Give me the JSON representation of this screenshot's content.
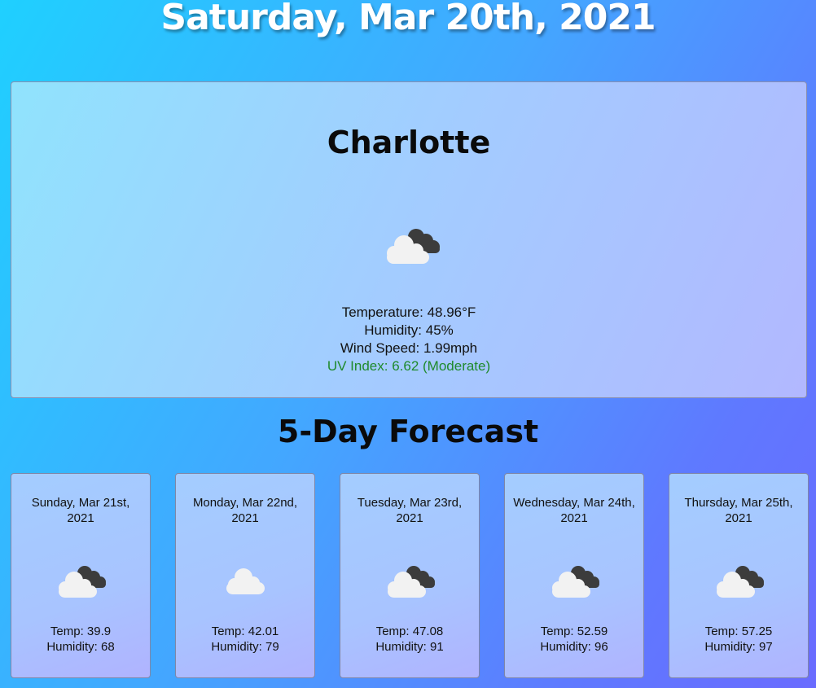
{
  "header": {
    "date": "Saturday, Mar 20th, 2021"
  },
  "current": {
    "city": "Charlotte",
    "icon": "cloudy-icon",
    "temperature": "Temperature: 48.96°F",
    "humidity": "Humidity: 45%",
    "wind": "Wind Speed: 1.99mph",
    "uv": "UV Index: 6.62 (Moderate)",
    "uv_color": "#1f8a2c"
  },
  "forecast": {
    "title": "5-Day Forecast",
    "days": [
      {
        "date": "Sunday, Mar 21st, 2021",
        "icon": "cloudy-icon",
        "temp": "Temp: 39.9",
        "humidity": "Humidity: 68"
      },
      {
        "date": "Monday, Mar 22nd, 2021",
        "icon": "cloud-icon",
        "temp": "Temp: 42.01",
        "humidity": "Humidity: 79"
      },
      {
        "date": "Tuesday, Mar 23rd, 2021",
        "icon": "cloudy-icon",
        "temp": "Temp: 47.08",
        "humidity": "Humidity: 91"
      },
      {
        "date": "Wednesday, Mar 24th, 2021",
        "icon": "cloudy-icon",
        "temp": "Temp: 52.59",
        "humidity": "Humidity: 96"
      },
      {
        "date": "Thursday, Mar 25th, 2021",
        "icon": "cloudy-icon",
        "temp": "Temp: 57.25",
        "humidity": "Humidity: 97"
      }
    ]
  }
}
